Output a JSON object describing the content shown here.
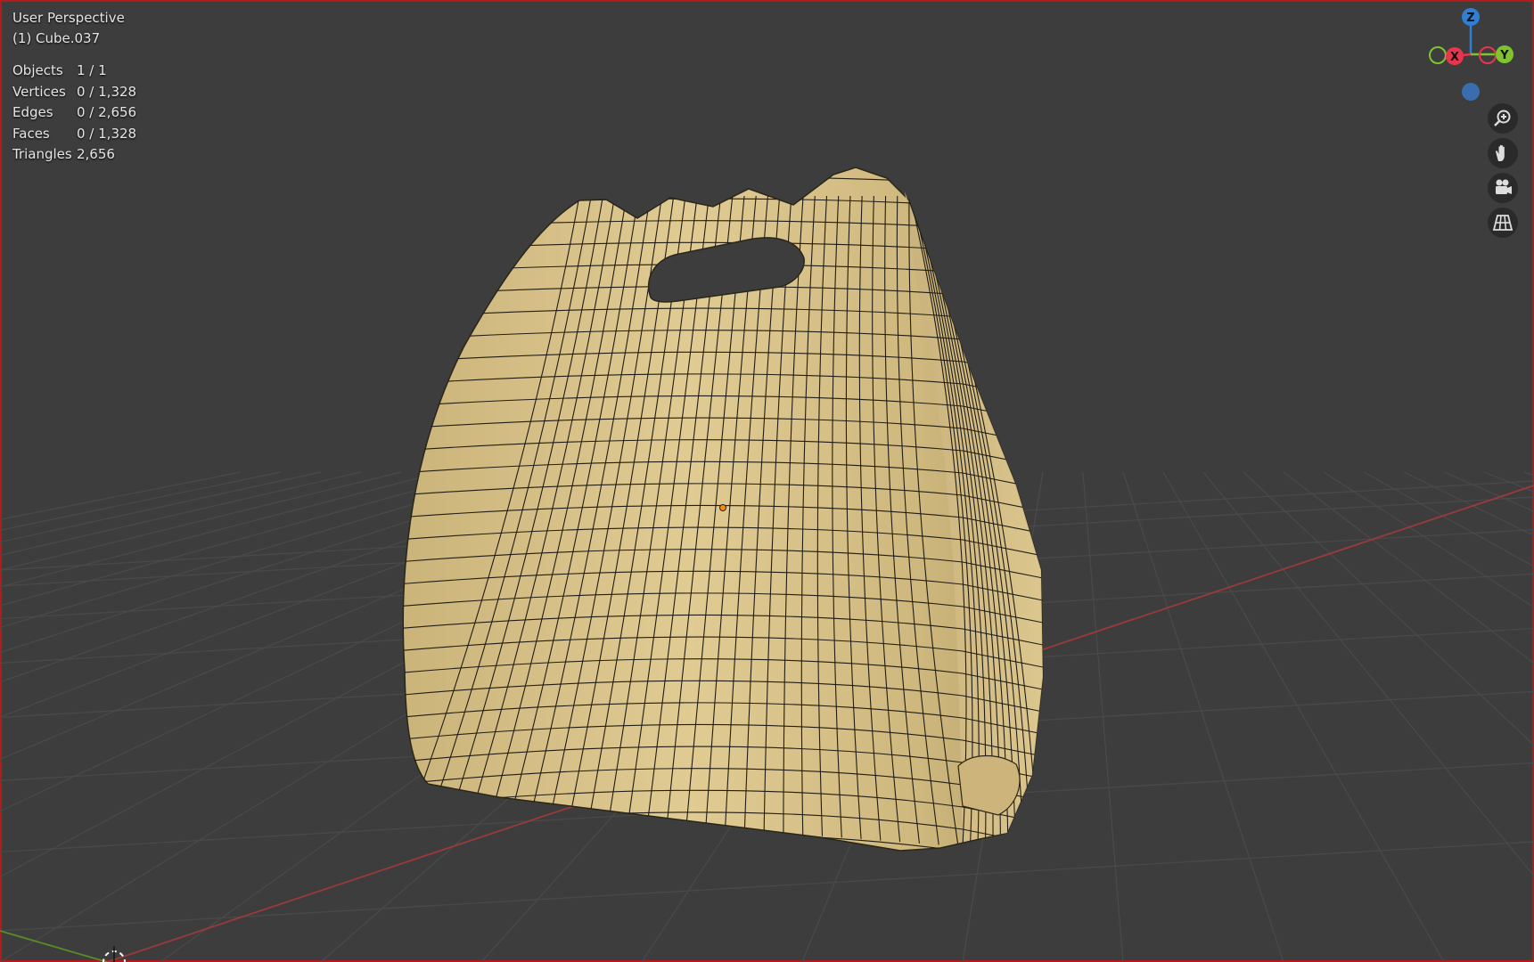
{
  "viewport": {
    "view_name": "User Perspective",
    "object_name": "(1) Cube.037"
  },
  "stats": [
    {
      "label": "Objects",
      "value": "1 / 1"
    },
    {
      "label": "Vertices",
      "value": "0 / 1,328"
    },
    {
      "label": "Edges",
      "value": "0 / 2,656"
    },
    {
      "label": "Faces",
      "value": "0 / 1,328"
    },
    {
      "label": "Triangles",
      "value": "2,656"
    }
  ],
  "gizmo": {
    "z_label": "Z",
    "x_label": "X",
    "y_label": "Y",
    "colors": {
      "x": "#e8354d",
      "y": "#7fc42d",
      "z": "#2f7fd6"
    }
  },
  "nav_buttons": [
    "zoom-icon",
    "hand-pan-icon",
    "camera-icon",
    "perspective-grid-icon"
  ],
  "colors": {
    "background": "#3d3d3d",
    "mesh_fill": "#d9c388",
    "wire": "#1f1c14",
    "x_axis": "#b03a3a",
    "y_axis": "#5f8f2c",
    "origin_dot": "#ff8c00"
  }
}
